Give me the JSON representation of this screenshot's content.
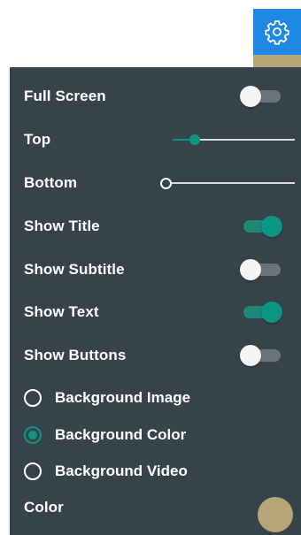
{
  "header": {
    "settings_icon": "gear-icon",
    "accent_color": "#1e88e5"
  },
  "panel": {
    "background": "#36434b",
    "rows": {
      "full_screen": {
        "label": "Full Screen",
        "on": false
      },
      "top": {
        "label": "Top",
        "value": 0.18
      },
      "bottom": {
        "label": "Bottom",
        "value": 0.0
      },
      "show_title": {
        "label": "Show Title",
        "on": true
      },
      "show_subtitle": {
        "label": "Show Subtitle",
        "on": false
      },
      "show_text": {
        "label": "Show Text",
        "on": true
      },
      "show_buttons": {
        "label": "Show Buttons",
        "on": false
      }
    },
    "background_options": [
      {
        "label": "Background Image",
        "checked": false
      },
      {
        "label": "Background Color",
        "checked": true
      },
      {
        "label": "Background Video",
        "checked": false
      }
    ],
    "color": {
      "label": "Color",
      "value": "#b7a57a"
    },
    "toggle_on_color": "#0b9683"
  }
}
